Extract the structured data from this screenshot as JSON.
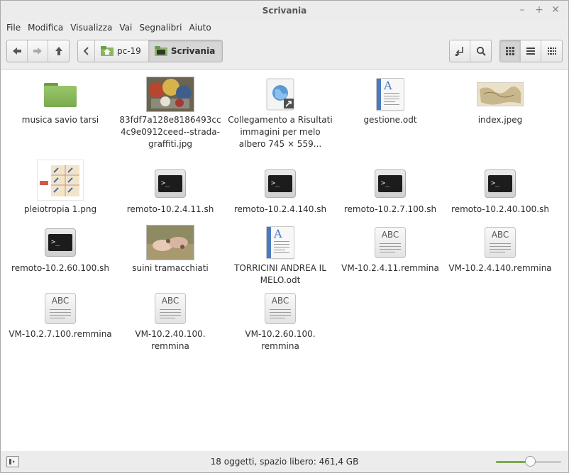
{
  "window": {
    "title": "Scrivania"
  },
  "menu": [
    "File",
    "Modifica",
    "Visualizza",
    "Vai",
    "Segnalibri",
    "Aiuto"
  ],
  "breadcrumb": [
    {
      "label": "pc-19",
      "icon": "home-folder-icon"
    },
    {
      "label": "Scrivania",
      "icon": "desktop-folder-icon"
    }
  ],
  "files": [
    {
      "name": "musica savio tarsi",
      "type": "folder",
      "icon": "folder-icon"
    },
    {
      "name": "83fdf7a128e8186493cc4c9e0912ceed--strada-graffiti.jpg",
      "type": "image",
      "icon": "graffiti-image-thumbnail"
    },
    {
      "name": "Collegamento a Risultati immagini per melo albero 745 × 559...",
      "type": "link",
      "icon": "web-link-icon"
    },
    {
      "name": "gestione.odt",
      "type": "document",
      "icon": "text-document-icon"
    },
    {
      "name": "index.jpeg",
      "type": "image",
      "icon": "map-image-thumbnail"
    },
    {
      "name": "pleiotropia 1.png",
      "type": "image",
      "icon": "diagram-image-thumbnail"
    },
    {
      "name": "remoto-10.2.4.11.sh",
      "type": "script",
      "icon": "terminal-icon"
    },
    {
      "name": "remoto-10.2.4.140.sh",
      "type": "script",
      "icon": "terminal-icon"
    },
    {
      "name": "remoto-10.2.7.100.sh",
      "type": "script",
      "icon": "terminal-icon"
    },
    {
      "name": "remoto-10.2.40.100.sh",
      "type": "script",
      "icon": "terminal-icon"
    },
    {
      "name": "remoto-10.2.60.100.sh",
      "type": "script",
      "icon": "terminal-icon"
    },
    {
      "name": "suini tramacchiati",
      "type": "image",
      "icon": "pigs-image-thumbnail"
    },
    {
      "name": "TORRICINI ANDREA IL MELO.odt",
      "type": "document",
      "icon": "text-document-icon"
    },
    {
      "name": "VM-10.2.4.11.remmina",
      "type": "remmina",
      "icon": "abc-file-icon"
    },
    {
      "name": "VM-10.2.4.140.remmina",
      "type": "remmina",
      "icon": "abc-file-icon"
    },
    {
      "name": "VM-10.2.7.100.remmina",
      "type": "remmina",
      "icon": "abc-file-icon"
    },
    {
      "name": "VM-10.2.40.100. remmina",
      "type": "remmina",
      "icon": "abc-file-icon"
    },
    {
      "name": "VM-10.2.60.100. remmina",
      "type": "remmina",
      "icon": "abc-file-icon"
    }
  ],
  "abc_text": "ABC",
  "terminal_prompt": ">_",
  "doc_letter": "A",
  "status": {
    "text": "18 oggetti, spazio libero: 461,4 GB"
  },
  "zoom": {
    "fraction": 0.52
  },
  "colors": {
    "accent": "#7aa94e",
    "doc_blue": "#4a7bbf"
  }
}
